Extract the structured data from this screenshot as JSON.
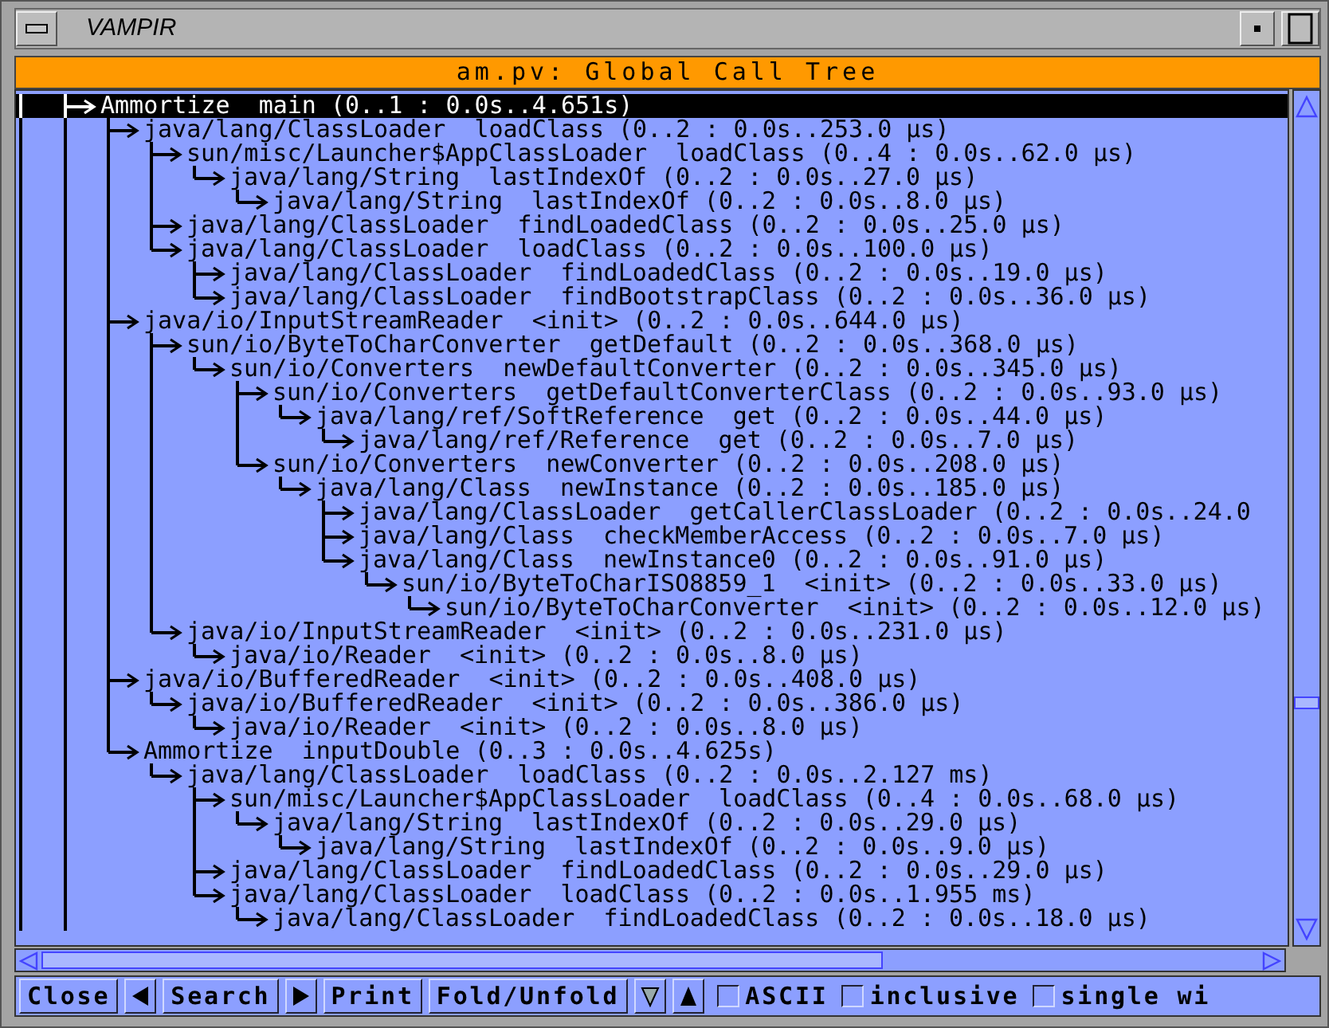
{
  "window": {
    "title": "VAMPIR"
  },
  "header": {
    "title": "am.pv: Global Call Tree"
  },
  "tree": {
    "rows": [
      {
        "text": "Ammortize  main (0..1 : 0.0s..4.651s)",
        "selected": true,
        "children": [
          {
            "text": "java/lang/ClassLoader  loadClass (0..2 : 0.0s..253.0 µs)",
            "selected": false,
            "children": [
              {
                "text": "sun/misc/Launcher$AppClassLoader  loadClass (0..4 : 0.0s..62.0 µs)",
                "selected": false,
                "children": [
                  {
                    "text": "java/lang/String  lastIndexOf (0..2 : 0.0s..27.0 µs)",
                    "selected": false,
                    "children": [
                      {
                        "text": "java/lang/String  lastIndexOf (0..2 : 0.0s..8.0 µs)",
                        "selected": false
                      }
                    ]
                  }
                ]
              },
              {
                "text": "java/lang/ClassLoader  findLoadedClass (0..2 : 0.0s..25.0 µs)",
                "selected": false
              },
              {
                "text": "java/lang/ClassLoader  loadClass (0..2 : 0.0s..100.0 µs)",
                "selected": false,
                "children": [
                  {
                    "text": "java/lang/ClassLoader  findLoadedClass (0..2 : 0.0s..19.0 µs)",
                    "selected": false
                  },
                  {
                    "text": "java/lang/ClassLoader  findBootstrapClass (0..2 : 0.0s..36.0 µs)",
                    "selected": false
                  }
                ]
              }
            ]
          },
          {
            "text": "java/io/InputStreamReader  <init> (0..2 : 0.0s..644.0 µs)",
            "selected": false,
            "children": [
              {
                "text": "sun/io/ByteToCharConverter  getDefault (0..2 : 0.0s..368.0 µs)",
                "selected": false,
                "children": [
                  {
                    "text": "sun/io/Converters  newDefaultConverter (0..2 : 0.0s..345.0 µs)",
                    "selected": false,
                    "children": [
                      {
                        "text": "sun/io/Converters  getDefaultConverterClass (0..2 : 0.0s..93.0 µs)",
                        "selected": false,
                        "children": [
                          {
                            "text": "java/lang/ref/SoftReference  get (0..2 : 0.0s..44.0 µs)",
                            "selected": false,
                            "children": [
                              {
                                "text": "java/lang/ref/Reference  get (0..2 : 0.0s..7.0 µs)",
                                "selected": false
                              }
                            ]
                          }
                        ]
                      },
                      {
                        "text": "sun/io/Converters  newConverter (0..2 : 0.0s..208.0 µs)",
                        "selected": false,
                        "children": [
                          {
                            "text": "java/lang/Class  newInstance (0..2 : 0.0s..185.0 µs)",
                            "selected": false,
                            "children": [
                              {
                                "text": "java/lang/ClassLoader  getCallerClassLoader (0..2 : 0.0s..24.0",
                                "selected": false
                              },
                              {
                                "text": "java/lang/Class  checkMemberAccess (0..2 : 0.0s..7.0 µs)",
                                "selected": false
                              },
                              {
                                "text": "java/lang/Class  newInstance0 (0..2 : 0.0s..91.0 µs)",
                                "selected": false,
                                "children": [
                                  {
                                    "text": "sun/io/ByteToCharISO8859_1  <init> (0..2 : 0.0s..33.0 µs)",
                                    "selected": false,
                                    "children": [
                                      {
                                        "text": "sun/io/ByteToCharConverter  <init> (0..2 : 0.0s..12.0 µs)",
                                        "selected": false
                                      }
                                    ]
                                  }
                                ]
                              }
                            ]
                          }
                        ]
                      }
                    ]
                  }
                ]
              },
              {
                "text": "java/io/InputStreamReader  <init> (0..2 : 0.0s..231.0 µs)",
                "selected": false,
                "children": [
                  {
                    "text": "java/io/Reader  <init> (0..2 : 0.0s..8.0 µs)",
                    "selected": false
                  }
                ]
              }
            ]
          },
          {
            "text": "java/io/BufferedReader  <init> (0..2 : 0.0s..408.0 µs)",
            "selected": false,
            "children": [
              {
                "text": "java/io/BufferedReader  <init> (0..2 : 0.0s..386.0 µs)",
                "selected": false,
                "children": [
                  {
                    "text": "java/io/Reader  <init> (0..2 : 0.0s..8.0 µs)",
                    "selected": false
                  }
                ]
              }
            ]
          },
          {
            "text": "Ammortize  inputDouble (0..3 : 0.0s..4.625s)",
            "selected": false,
            "children": [
              {
                "text": "java/lang/ClassLoader  loadClass (0..2 : 0.0s..2.127 ms)",
                "selected": false,
                "children": [
                  {
                    "text": "sun/misc/Launcher$AppClassLoader  loadClass (0..4 : 0.0s..68.0 µs)",
                    "selected": false,
                    "children": [
                      {
                        "text": "java/lang/String  lastIndexOf (0..2 : 0.0s..29.0 µs)",
                        "selected": false,
                        "children": [
                          {
                            "text": "java/lang/String  lastIndexOf (0..2 : 0.0s..9.0 µs)",
                            "selected": false
                          }
                        ]
                      }
                    ]
                  },
                  {
                    "text": "java/lang/ClassLoader  findLoadedClass (0..2 : 0.0s..29.0 µs)",
                    "selected": false
                  },
                  {
                    "text": "java/lang/ClassLoader  loadClass (0..2 : 0.0s..1.955 ms)",
                    "selected": false,
                    "children": [
                      {
                        "text": "java/lang/ClassLoader  findLoadedClass (0..2 : 0.0s..18.0 µs)",
                        "selected": false
                      }
                    ]
                  }
                ]
              }
            ]
          }
        ]
      }
    ]
  },
  "toolbar": [
    {
      "kind": "button",
      "label": "Close"
    },
    {
      "kind": "prev"
    },
    {
      "kind": "button",
      "label": "Search"
    },
    {
      "kind": "next"
    },
    {
      "kind": "button",
      "label": "Print"
    },
    {
      "kind": "button",
      "label": "Fold/Unfold"
    },
    {
      "kind": "down"
    },
    {
      "kind": "up"
    },
    {
      "kind": "checkbox",
      "label": "ASCII",
      "checked": false
    },
    {
      "kind": "checkbox",
      "label": "inclusive",
      "checked": false
    },
    {
      "kind": "checkbox",
      "label": "single wi",
      "checked": false
    }
  ]
}
